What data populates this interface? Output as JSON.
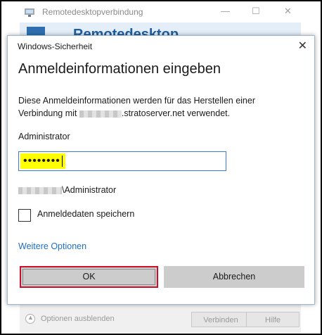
{
  "rdp_window": {
    "title": "Remotedesktopverbindung",
    "header_text": "Remotedesktop",
    "minimize_icon": "minimize-icon",
    "maximize_icon": "maximize-icon",
    "close_icon": "close-icon",
    "options_label": "Optionen ausblenden",
    "connect_label": "Verbinden",
    "help_label": "Hilfe"
  },
  "dialog": {
    "title": "Windows-Sicherheit",
    "heading": "Anmeldeinformationen eingeben",
    "description_part1": "Diese Anmeldeinformationen werden für das Herstellen einer Verbindung mit ",
    "description_part2": ".stratoserver.net verwendet.",
    "username": "Administrator",
    "password_mask": "••••••••",
    "domain_user_suffix": "\\Administrator",
    "remember_label": "Anmeldedaten speichern",
    "remember_checked": false,
    "more_options": "Weitere Optionen",
    "ok_label": "OK",
    "cancel_label": "Abbrechen"
  },
  "colors": {
    "link": "#1f6fc5",
    "highlight": "#ffff00",
    "ok_border": "#c8102e",
    "focus_border": "#3a7bd5"
  }
}
